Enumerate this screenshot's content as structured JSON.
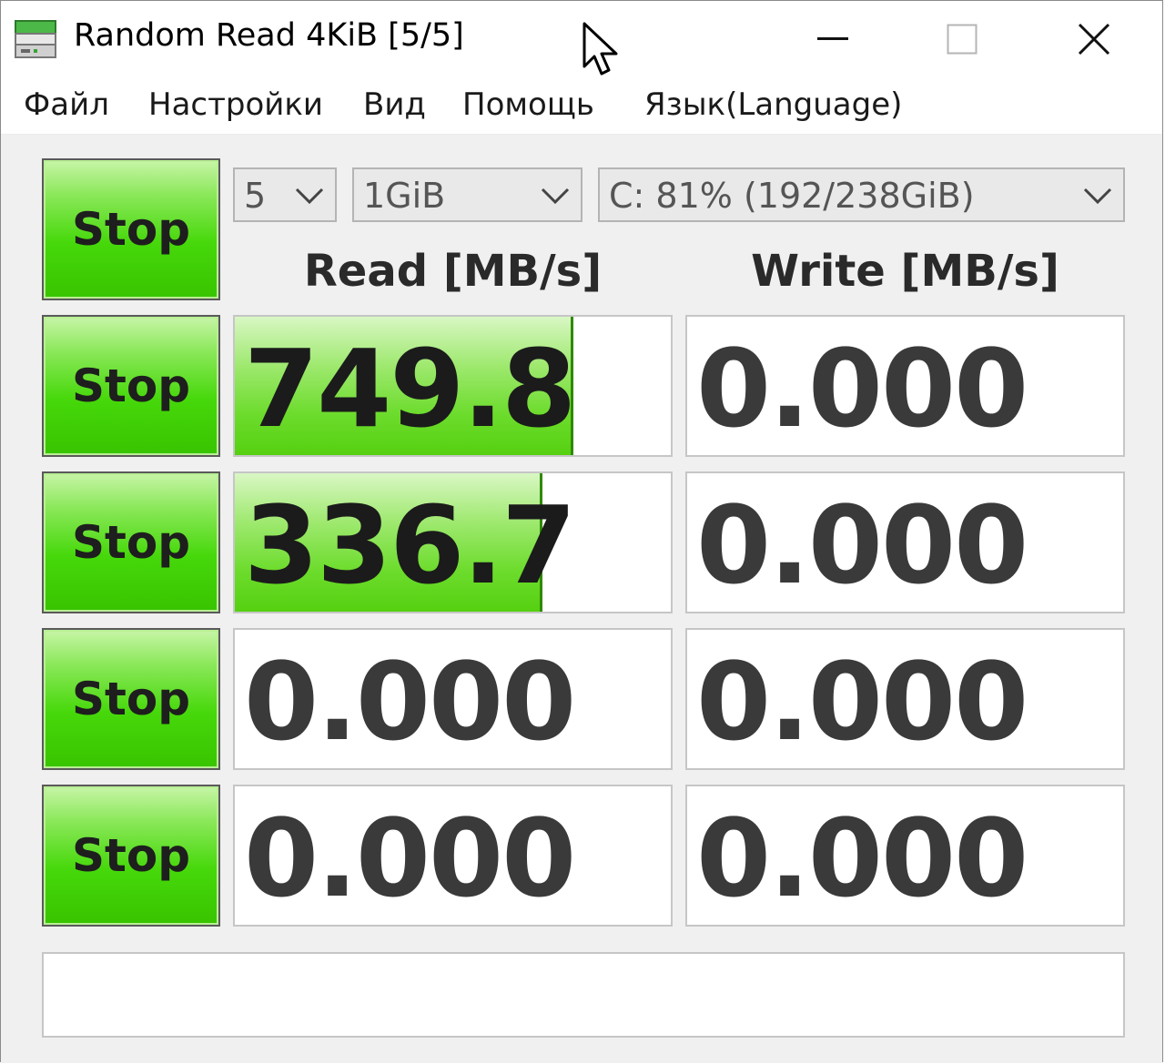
{
  "window": {
    "title": "Random Read 4KiB [5/5]",
    "icon": "disk-drive-icon",
    "controls": [
      "minimize-icon",
      "maximize-icon",
      "close-icon"
    ]
  },
  "menu": [
    "Файл",
    "Настройки",
    "Вид",
    "Помощь",
    "Язык(Language)"
  ],
  "toolbar": {
    "main_button": "Stop",
    "count_value": "5",
    "size_value": "1GiB",
    "drive_value": "C: 81% (192/238GiB)"
  },
  "headers": {
    "read": "Read [MB/s]",
    "write": "Write [MB/s]"
  },
  "rows": [
    {
      "button": "Stop",
      "read": "749.8",
      "write": "0.000",
      "read_fill": 0.77
    },
    {
      "button": "Stop",
      "read": "336.7",
      "write": "0.000",
      "read_fill": 0.7
    },
    {
      "button": "Stop",
      "read": "0.000",
      "write": "0.000",
      "read_fill": 0
    },
    {
      "button": "Stop",
      "read": "0.000",
      "write": "0.000",
      "read_fill": 0
    }
  ],
  "comment": "",
  "colors": {
    "button_green": "#46d80a",
    "bar_green": "#6ddc2d",
    "bar_edge": "#2f8a00"
  }
}
